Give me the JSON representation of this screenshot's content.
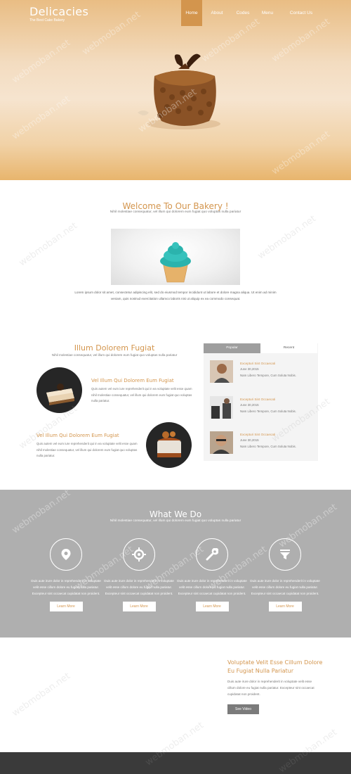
{
  "header": {
    "logo_title": "Delicacies",
    "logo_sub": "The Best Cake Bakery",
    "nav": [
      {
        "label": "Home",
        "active": true
      },
      {
        "label": "About",
        "active": false
      },
      {
        "label": "Codes",
        "active": false
      },
      {
        "label": "Menu",
        "active": false
      },
      {
        "label": "Contact Us",
        "active": false
      }
    ]
  },
  "welcome": {
    "title": "Welcome To Our Bakery !",
    "subtitle": "Nihil molestiae consequatur, vel illum qui dolorem eum fugiat quo voluptas nulla pariatur",
    "body": "Lorem ipsum dolor sit amet, consectetur adipiscing elit, sed do eiusmod tempor incididunt ut labore et dolore magna aliqua. Ut enim ad minim veniam, quis nostrud exercitation ullamco laboris nisi ut aliquip ex ea commodo consequat."
  },
  "illum": {
    "title": "Illum Dolorem Fugiat",
    "subtitle": "Nihil molestiae consequatur, vel illum qui dolorem eum fugiat quo voluptas nulla pariatur",
    "features": [
      {
        "heading": "Vel Illum Qui Dolorem Eum Fugiat",
        "text": "Quis autem vel eum iure reprehenderit qui in ea voluptate velit esse quam nihil molestiae consequatur, vel illum qui dolorem eum fugiat quo voluptas nulla pariatur."
      },
      {
        "heading": "Vel Illum Qui Dolorem Eum Fugiat",
        "text": "Quis autem vel eum iure reprehenderit qui in ea voluptate velit esse quam nihil molestiae consequatur, vel illum qui dolorem eum fugiat quo voluptas nulla pariatur."
      }
    ]
  },
  "tabs": {
    "labels": [
      "Popular",
      "Recent"
    ],
    "posts": [
      {
        "title": "Excepturi Sint Occaecati",
        "date": "June 30,2015",
        "text": "Nam Libero Tempore, Cum Soluta Nobis."
      },
      {
        "title": "Excepturi Sint Occaecati",
        "date": "June 30,2015",
        "text": "Nam Libero Tempore, Cum Soluta Nobis."
      },
      {
        "title": "Excepturi Sint Occaecati",
        "date": "June 30,2015",
        "text": "Nam Libero Tempore, Cum Soluta Nobis."
      }
    ]
  },
  "what_we_do": {
    "title": "What We Do",
    "subtitle": "Nihil molestiae consequatur, vel illum qui dolorem eum fugiat quo voluptas nulla pariatur",
    "services": [
      {
        "icon": "map-pin-icon",
        "text": "Duis aute irure dolor in reprehenderit in voluptate velit esse cillum dolore eu fugiat nulla pariatur. Excepteur sint occaecat cupidatat non proident.",
        "button": "Learn More"
      },
      {
        "icon": "gear-target-icon",
        "text": "Duis aute irure dolor in reprehenderit in voluptate velit esse cillum dolore eu fugiat nulla pariatur. Excepteur sint occaecat cupidatat non proident.",
        "button": "Learn More"
      },
      {
        "icon": "wrench-icon",
        "text": "Duis aute irure dolor in reprehenderit in voluptate velit esse cillum dolore eu fugiat nulla pariatur. Excepteur sint occaecat cupidatat non proident.",
        "button": "Learn More"
      },
      {
        "icon": "filter-icon",
        "text": "Duis aute irure dolor in reprehenderit in voluptate velit esse cillum dolore eu fugiat nulla pariatur. Excepteur sint occaecat cupidatat non proident.",
        "button": "Learn More"
      }
    ]
  },
  "video": {
    "title": "Voluptate Velit Esse Cillum Dolore Eu Fugiat Nulla Pariatur",
    "text": "Duis aute irure dolor in reprehenderit in voluptate velit esse cillum dolore eu fugiat nulla pariatur. Excepteur sint occaecat cupidatat non proident.",
    "button": "See Video"
  },
  "watermark": "webmoban.net",
  "colors": {
    "accent": "#d3954d",
    "grey_band": "#afafaf",
    "footer": "#3a3a3a"
  }
}
